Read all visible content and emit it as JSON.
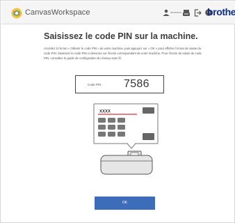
{
  "header": {
    "app_title": "CanvasWorkspace",
    "user_name": "xxxxxxx",
    "brand": "brother",
    "icons": [
      "canvasworkspace-logo-icon",
      "user-icon",
      "machine-icon",
      "sign-out-icon",
      "help-icon"
    ]
  },
  "main": {
    "title": "Saisissez le code PIN sur la machine.",
    "instructions": "Accédez à l'écran « Obtenir le code PIN » de votre machine, puis appuyez sur « OK » pour afficher l'écran de saisie du code PIN. Saisissez le code PIN ci-dessous sur l'écran correspondant de votre machine. Pour l'écran de saisie du code PIN, consultez le guide de configuration du réseau sans fil.",
    "pin_label": "Code PIN",
    "pin_value": "7586",
    "illustration": {
      "screen_text": "XXXX"
    },
    "ok_label": "OK"
  },
  "colors": {
    "accent": "#3d6db8",
    "brand": "#0d2d8a",
    "pin_entry_highlight": "#e3555b"
  }
}
